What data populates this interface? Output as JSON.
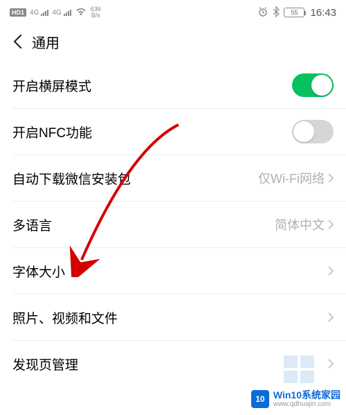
{
  "status": {
    "hd": "HD1",
    "sig1_label": "4G",
    "sig2_label": "4G",
    "speed_num": "636",
    "speed_unit": "B/s",
    "battery": "55",
    "time": "16:43"
  },
  "header": {
    "title": "通用"
  },
  "rows": {
    "landscape": {
      "label": "开启横屏模式",
      "on": true
    },
    "nfc": {
      "label": "开启NFC功能",
      "on": false
    },
    "download": {
      "label": "自动下载微信安装包",
      "value": "仅Wi-Fi网络"
    },
    "lang": {
      "label": "多语言",
      "value": "简体中文"
    },
    "font": {
      "label": "字体大小"
    },
    "media": {
      "label": "照片、视频和文件"
    },
    "discover": {
      "label": "发现页管理"
    }
  },
  "watermark": {
    "logo_text": "10",
    "line1": "Win10系统家园",
    "line2": "www.qdhuajin.com"
  }
}
